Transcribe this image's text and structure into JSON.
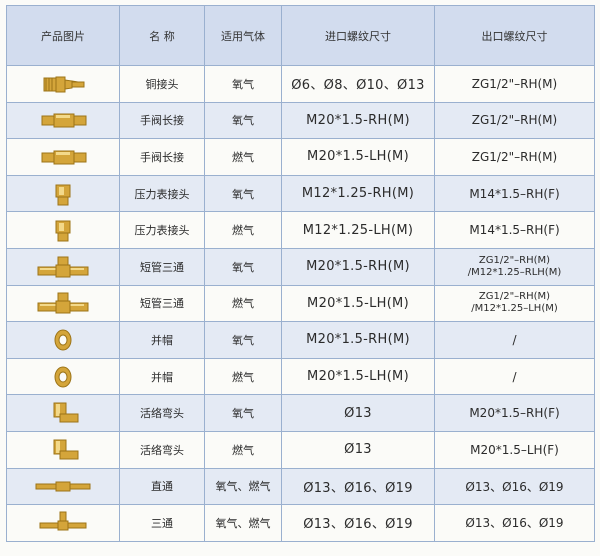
{
  "headers": {
    "photo": "产品图片",
    "name": "名 称",
    "gas": "适用气体",
    "inlet": "进口螺纹尺寸",
    "outlet": "出口螺纹尺寸"
  },
  "rows": [
    {
      "icon": "brass-hose-barb-fitting-icon",
      "name": "铜接头",
      "gas": "氧气",
      "inlet": "Ø6、Ø8、Ø10、Ø13",
      "outlet": [
        "ZG1/2\"–RH(M)"
      ]
    },
    {
      "icon": "brass-valve-extension-icon",
      "name": "手阀长接",
      "gas": "氧气",
      "inlet": "M20*1.5-RH(M)",
      "outlet": [
        "ZG1/2\"–RH(M)"
      ]
    },
    {
      "icon": "brass-valve-extension-icon",
      "name": "手阀长接",
      "gas": "燃气",
      "inlet": "M20*1.5-LH(M)",
      "outlet": [
        "ZG1/2\"–RH(M)"
      ]
    },
    {
      "icon": "brass-gauge-connector-icon",
      "name": "压力表接头",
      "gas": "氧气",
      "inlet": "M12*1.25-RH(M)",
      "outlet": [
        "M14*1.5–RH(F)"
      ]
    },
    {
      "icon": "brass-gauge-connector-icon",
      "name": "压力表接头",
      "gas": "燃气",
      "inlet": "M12*1.25-LH(M)",
      "outlet": [
        "M14*1.5–RH(F)"
      ]
    },
    {
      "icon": "brass-short-tee-icon",
      "name": "短管三通",
      "gas": "氧气",
      "inlet": "M20*1.5-RH(M)",
      "outlet": [
        "ZG1/2\"–RH(M)",
        "/M12*1.25–RLH(M)"
      ]
    },
    {
      "icon": "brass-short-tee-icon",
      "name": "短管三通",
      "gas": "燃气",
      "inlet": "M20*1.5-LH(M)",
      "outlet": [
        "ZG1/2\"–RH(M)",
        "/M12*1.25–LH(M)"
      ]
    },
    {
      "icon": "brass-nut-icon",
      "name": "并帽",
      "gas": "氧气",
      "inlet": "M20*1.5-RH(M)",
      "outlet": [
        "/"
      ]
    },
    {
      "icon": "brass-nut-icon",
      "name": "并帽",
      "gas": "燃气",
      "inlet": "M20*1.5-LH(M)",
      "outlet": [
        "/"
      ]
    },
    {
      "icon": "brass-swivel-elbow-icon",
      "name": "活络弯头",
      "gas": "氧气",
      "inlet": "Ø13",
      "outlet": [
        "M20*1.5–RH(F)"
      ]
    },
    {
      "icon": "brass-swivel-elbow-icon",
      "name": "活络弯头",
      "gas": "燃气",
      "inlet": "Ø13",
      "outlet": [
        "M20*1.5–LH(F)"
      ]
    },
    {
      "icon": "brass-straight-connector-icon",
      "name": "直通",
      "gas": "氧气、燃气",
      "inlet": "Ø13、Ø16、Ø19",
      "outlet": [
        "Ø13、Ø16、Ø19"
      ]
    },
    {
      "icon": "brass-tee-connector-icon",
      "name": "三通",
      "gas": "氧气、燃气",
      "inlet": "Ø13、Ø16、Ø19",
      "outlet": [
        "Ø13、Ø16、Ø19"
      ]
    }
  ],
  "colors": {
    "header_bg": "#d2dcee",
    "stripe_bg": "#e4eaf4",
    "border": "#9ab0cf",
    "brass": "#d4a53a"
  }
}
